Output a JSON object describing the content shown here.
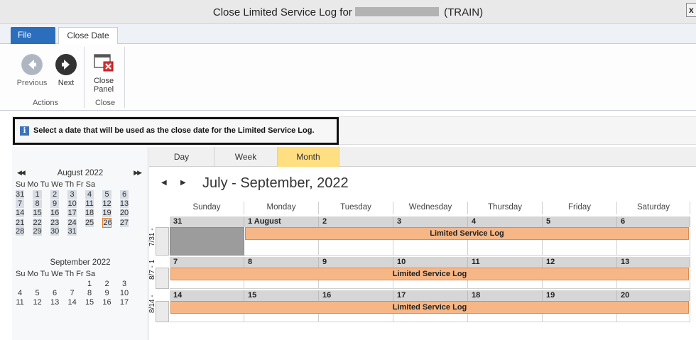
{
  "window": {
    "title_prefix": "Close Limited Service Log for",
    "title_suffix": "(TRAIN)",
    "close_glyph": "x"
  },
  "ribbon": {
    "tabs": [
      {
        "label": "File",
        "active": false
      },
      {
        "label": "Close Date",
        "active": true
      }
    ],
    "groups": [
      {
        "label": "Actions",
        "buttons": [
          {
            "label": "Previous",
            "icon": "arrow-left-circle-icon",
            "enabled": false
          },
          {
            "label": "Next",
            "icon": "arrow-right-circle-icon",
            "enabled": true
          }
        ]
      },
      {
        "label": "Close",
        "buttons": [
          {
            "label_line1": "Close",
            "label_line2": "Panel",
            "icon": "close-panel-icon",
            "enabled": true
          }
        ]
      }
    ]
  },
  "info": {
    "icon": "info-icon",
    "message": "Select a date that will be used as the close date for the Limited Service Log."
  },
  "mini_calendars": [
    {
      "title": "August 2022",
      "prev_glyph": "◀◀",
      "next_glyph": "▶▶",
      "dow": "Su Mo Tu We Th Fr Sa",
      "weeks": [
        [
          "31",
          "1",
          "2",
          "3",
          "4",
          "5",
          "6"
        ],
        [
          "7",
          "8",
          "9",
          "10",
          "11",
          "12",
          "13"
        ],
        [
          "14",
          "15",
          "16",
          "17",
          "18",
          "19",
          "20"
        ],
        [
          "21",
          "22",
          "23",
          "24",
          "25",
          "26",
          "27"
        ],
        [
          "28",
          "29",
          "30",
          "31",
          "",
          "",
          ""
        ]
      ],
      "today": "26"
    },
    {
      "title": "September 2022",
      "dow": "Su Mo Tu We Th Fr Sa",
      "weeks": [
        [
          "",
          "",
          "",
          "",
          "1",
          "2",
          "3"
        ],
        [
          "4",
          "5",
          "6",
          "7",
          "8",
          "9",
          "10"
        ],
        [
          "11",
          "12",
          "13",
          "14",
          "15",
          "16",
          "17"
        ]
      ]
    }
  ],
  "calendar": {
    "view_tabs": [
      {
        "label": "Day",
        "active": false
      },
      {
        "label": "Week",
        "active": false
      },
      {
        "label": "Month",
        "active": true
      }
    ],
    "range_title": "July - September, 2022",
    "prev_glyph": "◀",
    "next_glyph": "▶",
    "days_of_week": [
      "Sunday",
      "Monday",
      "Tuesday",
      "Wednesday",
      "Thursday",
      "Friday",
      "Saturday"
    ],
    "weeks": [
      {
        "label": "7/31 -",
        "dates": [
          "31",
          "1 August",
          "2",
          "3",
          "4",
          "5",
          "6"
        ],
        "event": "Limited Service Log",
        "event_start_col": 1
      },
      {
        "label": "8/7 - 1",
        "dates": [
          "7",
          "8",
          "9",
          "10",
          "11",
          "12",
          "13"
        ],
        "event": "Limited Service Log",
        "event_start_col": 0
      },
      {
        "label": "8/14 -",
        "dates": [
          "14",
          "15",
          "16",
          "17",
          "18",
          "19",
          "20"
        ],
        "event": "Limited Service Log",
        "event_start_col": 0
      }
    ],
    "colors": {
      "active_tab": "#ffdf82",
      "event_fill": "#f7b686",
      "ribbon_file_tab": "#2a6ebd"
    }
  }
}
